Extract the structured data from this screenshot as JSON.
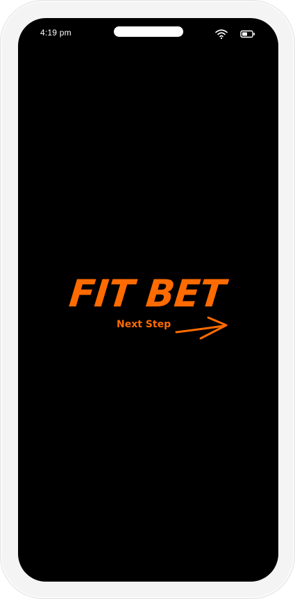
{
  "status_bar": {
    "time": "4:19 pm",
    "icons": [
      "wifi-icon",
      "battery-icon"
    ]
  },
  "splash": {
    "logo": "FIT BET",
    "tagline": "Next Step",
    "arrow_icon": "arrow-right-icon"
  },
  "colors": {
    "accent": "#ff6b00",
    "screen_background": "#000000",
    "frame": "#f4f4f4",
    "status_text": "#ffffff"
  }
}
